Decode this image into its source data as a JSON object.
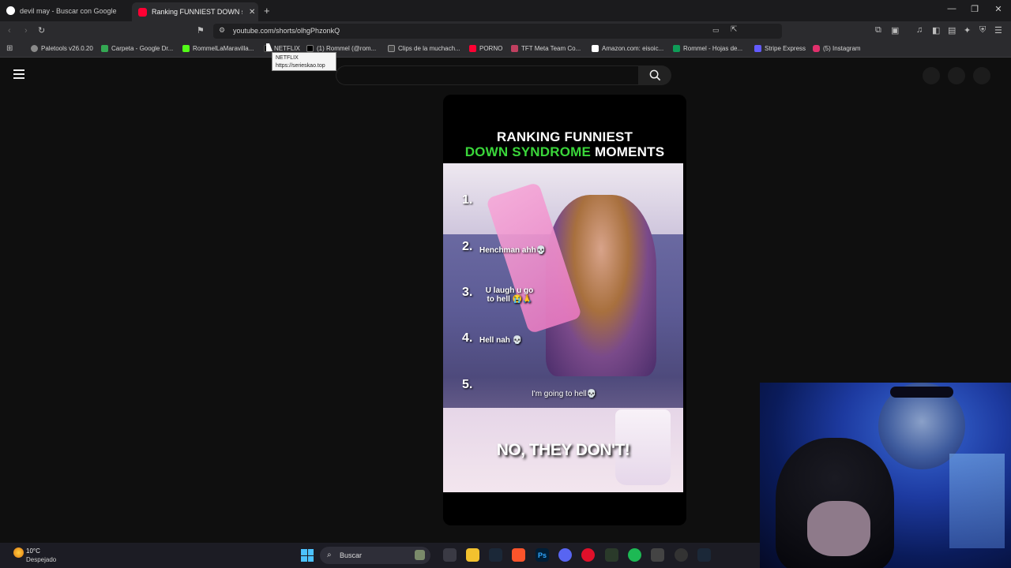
{
  "browser": {
    "tabs": [
      {
        "title": "devil may - Buscar con Google",
        "favicon_color": "#ffffff"
      },
      {
        "title": "Ranking FUNNIEST DOWN syndr",
        "favicon_color": "#ff0033"
      }
    ],
    "new_tab_glyph": "+",
    "url": "youtube.com/shorts/olhgPhzonkQ",
    "bookmarks": [
      {
        "label": "Paletools v26.0.20",
        "color": "#8a8a8a"
      },
      {
        "label": "Carpeta - Google Dr...",
        "color": "#34a853"
      },
      {
        "label": "RommelLaMaravilla...",
        "color": "#53fc18"
      },
      {
        "label": "NETFLIX",
        "color": "#111111"
      },
      {
        "label": "(1) Rommel (@rom...",
        "color": "#000000"
      },
      {
        "label": "Clips de la muchach...",
        "color": "#444444"
      },
      {
        "label": "PORNO",
        "color": "#ff0033"
      },
      {
        "label": "TFT Meta Team Co...",
        "color": "#c04060"
      },
      {
        "label": "Amazon.com: eisoic...",
        "color": "#ffffff"
      },
      {
        "label": "Rommel - Hojas de...",
        "color": "#0f9d58"
      },
      {
        "label": "Stripe Express",
        "color": "#635bff"
      },
      {
        "label": "(5) Instagram",
        "color": "#e1306c"
      }
    ],
    "tooltip": {
      "title": "NETFLIX",
      "url": "https://serieskao.top"
    }
  },
  "short": {
    "title_line1": "RANKING FUNNIEST",
    "title_line2_green": "DOWN SYNDROME",
    "title_line2_white": " MOMENTS",
    "ranks": [
      "1.",
      "2.",
      "3.",
      "4.",
      "5."
    ],
    "captions": {
      "c2": "Henchman ahh💀",
      "c3a": "U laugh u go",
      "c3b": "to hell 😭🙏",
      "c4": "Hell nah 💀",
      "c5": "I'm going to hell💀"
    },
    "subtitle": "NO, THEY DON'T!"
  },
  "taskbar": {
    "weather_temp": "10°C",
    "weather_desc": "Despejado",
    "search_placeholder": "Buscar"
  }
}
